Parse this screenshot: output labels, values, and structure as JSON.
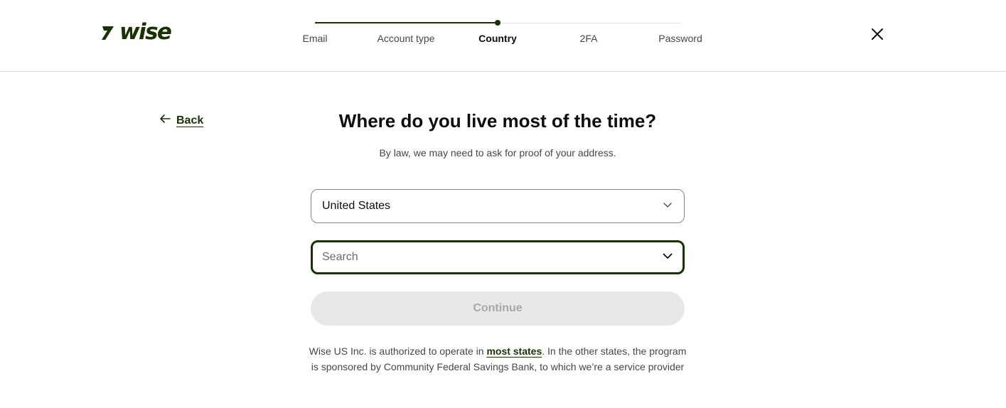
{
  "brand": {
    "name": "wise",
    "logo_icon": "wise-flag-icon",
    "color": "#163300"
  },
  "stepper": {
    "steps": [
      {
        "label": "Email",
        "state": "done"
      },
      {
        "label": "Account type",
        "state": "done"
      },
      {
        "label": "Country",
        "state": "active"
      },
      {
        "label": "2FA",
        "state": "todo"
      },
      {
        "label": "Password",
        "state": "todo"
      }
    ],
    "progress_fraction": 0.5
  },
  "header": {
    "close_icon": "close-icon"
  },
  "nav": {
    "back_label": "Back",
    "back_icon": "arrow-left-icon"
  },
  "main": {
    "title": "Where do you live most of the time?",
    "subtitle": "By law, we may need to ask for proof of your address.",
    "country_select": {
      "value": "United States",
      "icon": "chevron-down-icon"
    },
    "state_search": {
      "placeholder": "Search",
      "value": "",
      "icon": "chevron-down-icon"
    },
    "continue_label": "Continue"
  },
  "disclaimer": {
    "before": "Wise US Inc. is authorized to operate in ",
    "link": "most states",
    "after": ". In the other states, the program is sponsored by Community Federal Savings Bank, to which we’re a service provider"
  },
  "colors": {
    "accent": "#163300",
    "border": "#868685",
    "disabled_bg": "#e8e8e8",
    "disabled_text": "#a8a8a6"
  }
}
